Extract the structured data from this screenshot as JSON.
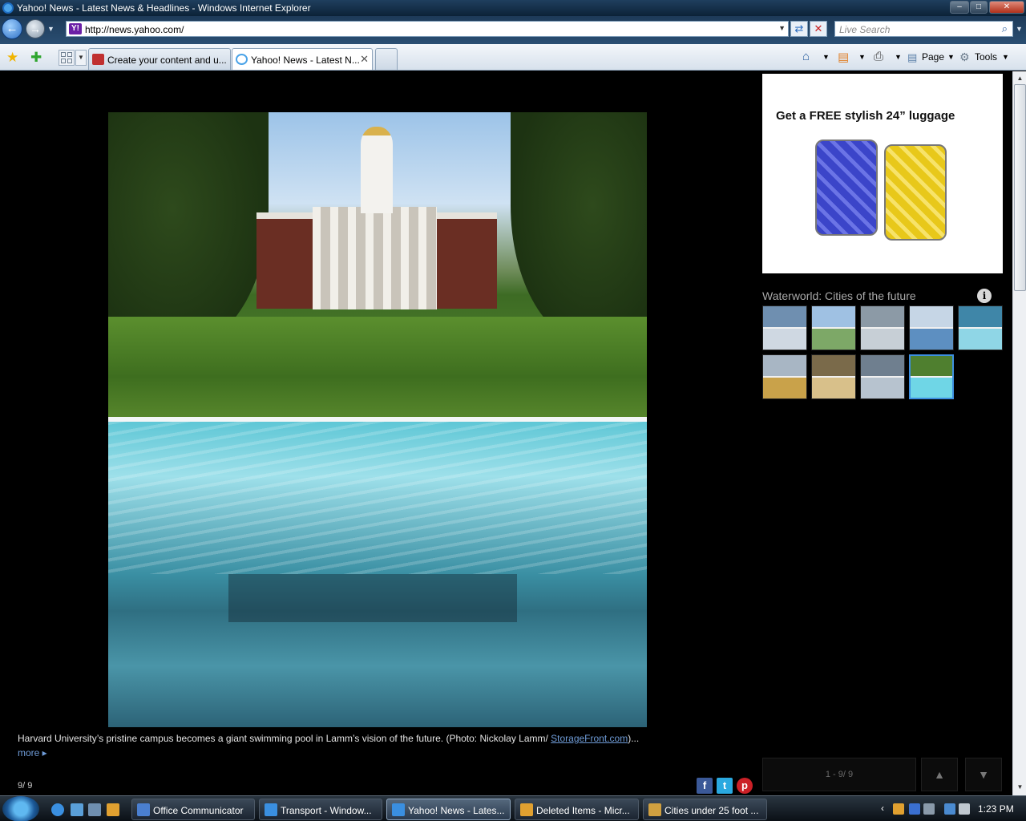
{
  "window": {
    "title": "Yahoo! News - Latest News & Headlines - Windows Internet Explorer",
    "min_glyph": "–",
    "max_glyph": "□",
    "close_glyph": "✕"
  },
  "nav": {
    "back_glyph": "←",
    "forward_glyph": "→",
    "dropdown_glyph": "▼",
    "address_favicon": "Y!",
    "address_url": "http://news.yahoo.com/",
    "refresh_glyph": "⇄",
    "stop_glyph": "✕",
    "search_placeholder": "Live Search",
    "search_glyph": "⌕"
  },
  "command_bar": {
    "favorites_glyph": "★",
    "add_favorites_glyph": "✚",
    "tab_list_glyph": "▼",
    "tabs": [
      {
        "label": "Create your content and u..."
      },
      {
        "label": "Yahoo! News - Latest N...",
        "close_glyph": "✕"
      }
    ],
    "home_glyph": "⌂",
    "feeds_glyph": "▤",
    "print_glyph": "⎙",
    "page_label": "Page",
    "tools_label": "Tools",
    "dropdown_glyph": "▼"
  },
  "slideshow": {
    "caption_text": "Harvard University’s pristine campus becomes a giant swimming pool in Lamm’s vision of the future. (Photo: Nickolay Lamm/ ",
    "caption_link": "StorageFront.com",
    "caption_tail": ")...",
    "more_label": "more ▸",
    "counter": "9/ 9",
    "share": {
      "facebook": "f",
      "twitter": "t",
      "pinterest": "p"
    }
  },
  "ad": {
    "title": "Get a FREE stylish 24” luggage"
  },
  "gallery": {
    "title": "Waterworld: Cities of the future",
    "info_glyph": "i",
    "pager_label": "1 - 9/ 9",
    "prev_glyph": "▲",
    "next_glyph": "▼",
    "thumbnails": [
      {
        "colors": [
          "#6f8fb0",
          "#cfd8e2"
        ]
      },
      {
        "colors": [
          "#9fc1e3",
          "#7da867"
        ]
      },
      {
        "colors": [
          "#8c9aa6",
          "#c7cfd6"
        ]
      },
      {
        "colors": [
          "#c6d6e6",
          "#5d8fc1"
        ]
      },
      {
        "colors": [
          "#3f86a8",
          "#8fd6e6"
        ]
      },
      {
        "colors": [
          "#a8b6c4",
          "#c9a24a"
        ]
      },
      {
        "colors": [
          "#7a6a4a",
          "#d8c08a"
        ]
      },
      {
        "colors": [
          "#6f7f8f",
          "#b7c3cf"
        ]
      },
      {
        "colors": [
          "#4f7f2f",
          "#6fd6e6"
        ]
      }
    ]
  },
  "scrollbar": {
    "up_glyph": "▲",
    "down_glyph": "▼"
  },
  "taskbar": {
    "tasks": [
      {
        "label": "Office Communicator",
        "color": "#4a7fd0"
      },
      {
        "label": "Transport - Window...",
        "color": "#3a8fe0"
      },
      {
        "label": "Yahoo! News - Lates...",
        "color": "#3a8fe0"
      },
      {
        "label": "Deleted Items - Micr...",
        "color": "#e0a030"
      },
      {
        "label": "Cities under 25 foot ...",
        "color": "#d0a040"
      }
    ],
    "tray_chevron": "‹",
    "clock": "1:23 PM"
  },
  "colors": {
    "titlebar": "#1f3f5e",
    "link": "#6f9cd8",
    "selected_thumb": "#3d8fe0",
    "facebook": "#3b5998",
    "twitter": "#2aa9e0",
    "pinterest": "#cb2027"
  }
}
